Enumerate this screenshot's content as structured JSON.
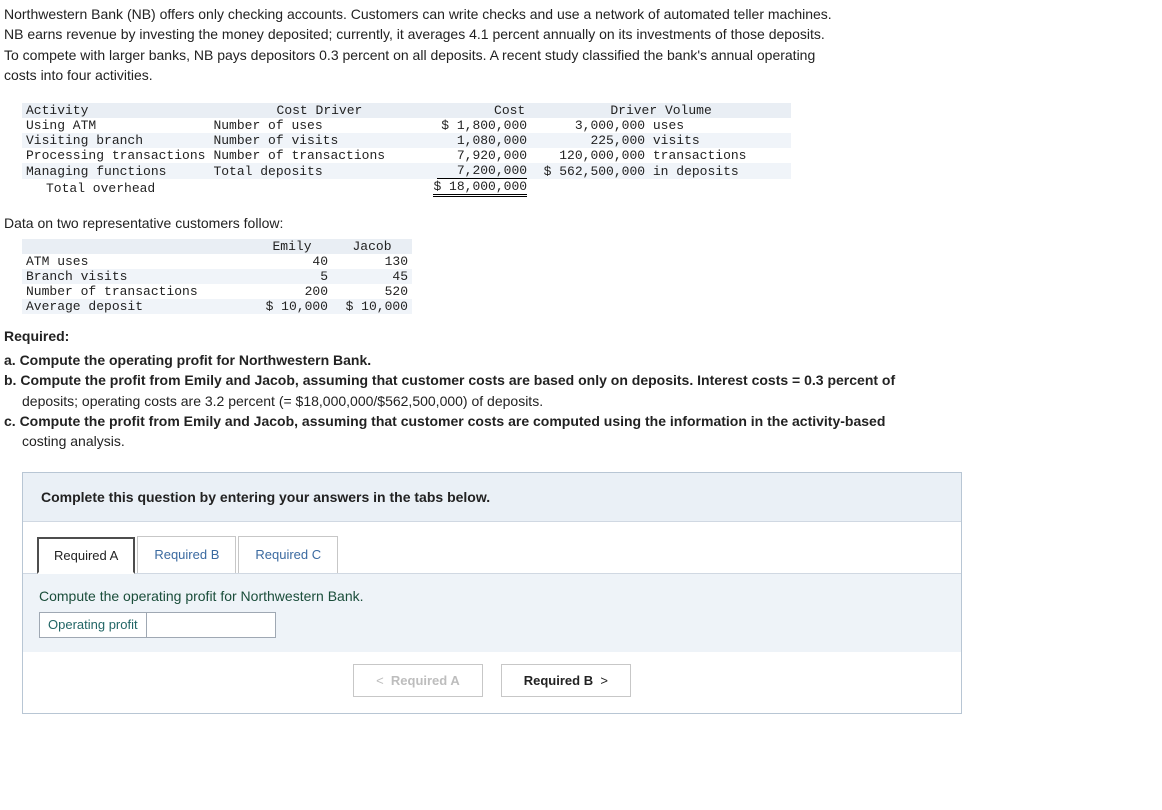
{
  "intro": {
    "l1": "Northwestern Bank (NB) offers only checking accounts. Customers can write checks and use a network of automated teller machines.",
    "l2": "NB earns revenue by investing the money deposited; currently, it averages 4.1 percent annually on its investments of those deposits.",
    "l3": "To compete with larger banks, NB pays depositors 0.3 percent on all deposits. A recent study classified the bank's annual operating",
    "l4": "costs into four activities."
  },
  "t1": {
    "head": {
      "c1": "Activity",
      "c2": "Cost Driver",
      "c3": "Cost",
      "c4": "Driver Volume"
    },
    "rows": [
      {
        "act": "Using ATM",
        "drv": "Number of uses",
        "cost": "$ 1,800,000",
        "vol": "3,000,000",
        "volu": " uses"
      },
      {
        "act": "Visiting branch",
        "drv": "Number of visits",
        "cost": "1,080,000",
        "vol": "225,000",
        "volu": " visits"
      },
      {
        "act": "Processing transactions",
        "drv": "Number of transactions",
        "cost": "7,920,000",
        "vol": "120,000,000",
        "volu": " transactions"
      },
      {
        "act": "Managing functions",
        "drv": "Total deposits",
        "cost": "7,200,000",
        "vol": "$ 562,500,000",
        "volu": " in deposits"
      }
    ],
    "total_lbl": "Total overhead",
    "total_cost": "$ 18,000,000"
  },
  "sub1": "Data on two representative customers follow:",
  "t2": {
    "head": {
      "c1": "Emily",
      "c2": "Jacob"
    },
    "rows": [
      {
        "lbl": "ATM uses",
        "e": "40",
        "j": "130"
      },
      {
        "lbl": "Branch visits",
        "e": "5",
        "j": "45"
      },
      {
        "lbl": "Number of transactions",
        "e": "200",
        "j": "520"
      },
      {
        "lbl": "Average deposit",
        "e": "$ 10,000",
        "j": "$ 10,000"
      }
    ]
  },
  "req": {
    "title": "Required:",
    "a": "a. Compute the operating profit for Northwestern Bank.",
    "b1": "b. Compute the profit from Emily and Jacob, assuming that customer costs are based only on deposits. Interest costs = 0.3 percent of",
    "b2": "deposits; operating costs are 3.2 percent (= $18,000,000/$562,500,000) of deposits.",
    "c1": "c. Compute the profit from Emily and Jacob, assuming that customer costs are computed using the information in the activity-based",
    "c2": "costing analysis."
  },
  "ans": {
    "instr": "Complete this question by entering your answers in the tabs below.",
    "tabs": {
      "a": "Required A",
      "b": "Required B",
      "c": "Required C"
    },
    "body_text": "Compute the operating profit for Northwestern Bank.",
    "row_label": "Operating profit",
    "nav_prev": "Required A",
    "nav_next": "Required B"
  }
}
